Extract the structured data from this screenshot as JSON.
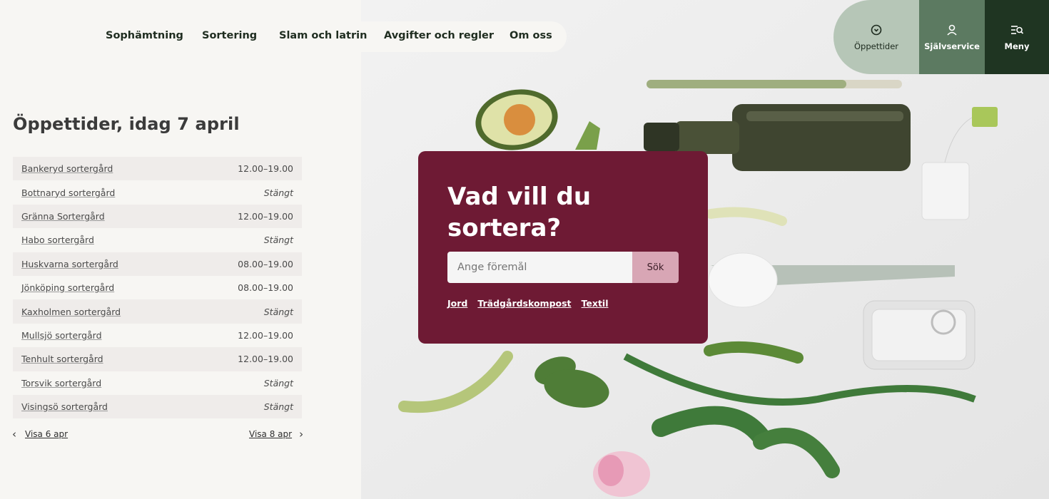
{
  "nav": {
    "items": [
      "Sophämtning",
      "Sortering",
      "Slam och latrin",
      "Avgifter och regler",
      "Om oss"
    ]
  },
  "utility": {
    "opening_hours": "Öppettider",
    "self_service": "Självservice",
    "menu": "Meny"
  },
  "hours": {
    "title": "Öppettider, idag 7 april",
    "rows": [
      {
        "name": "Bankeryd sortergård",
        "time": "12.00–19.00"
      },
      {
        "name": "Bottnaryd sortergård",
        "time": "Stängt"
      },
      {
        "name": "Gränna Sortergård",
        "time": "12.00–19.00"
      },
      {
        "name": "Habo sortergård",
        "time": "Stängt"
      },
      {
        "name": "Huskvarna sortergård",
        "time": "08.00–19.00"
      },
      {
        "name": "Jönköping sortergård",
        "time": "08.00–19.00"
      },
      {
        "name": "Kaxholmen sortergård",
        "time": "Stängt"
      },
      {
        "name": "Mullsjö sortergård",
        "time": "12.00–19.00"
      },
      {
        "name": "Tenhult sortergård",
        "time": "12.00–19.00"
      },
      {
        "name": "Torsvik sortergård",
        "time": "Stängt"
      },
      {
        "name": "Visingsö sortergård",
        "time": "Stängt"
      }
    ],
    "prev_label": "Visa 6 apr",
    "next_label": "Visa 8 apr"
  },
  "search": {
    "heading": "Vad vill du sortera?",
    "placeholder": "Ange föremål",
    "button": "Sök",
    "quick_links": [
      "Jord",
      "Trädgårdskompost",
      "Textil"
    ]
  },
  "colors": {
    "card": "#6e1a34",
    "util_light": "#b6c6b7",
    "util_mid": "#5c7a61",
    "util_dark": "#1f3522"
  },
  "icons": {
    "opening_hours": "clock-icon",
    "self_service": "person-icon",
    "menu": "menu-search-icon",
    "prev": "chevron-left-icon",
    "next": "chevron-right-icon"
  }
}
